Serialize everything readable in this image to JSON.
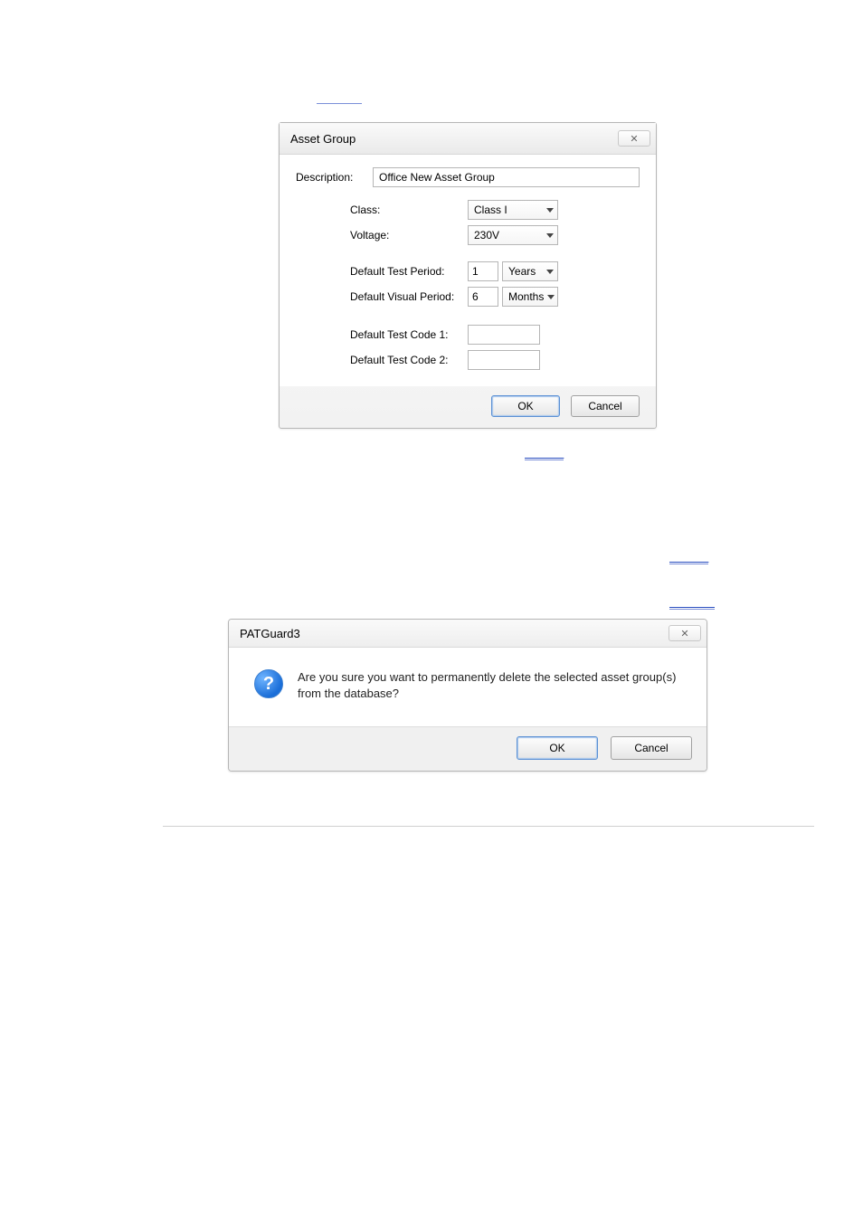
{
  "intro_link": "",
  "dialog1": {
    "title": "Asset Group",
    "close": "✕",
    "description_label": "Description:",
    "description_value": "Office New Asset Group",
    "class_label": "Class:",
    "class_value": "Class I",
    "voltage_label": "Voltage:",
    "voltage_value": "230V",
    "test_period_label": "Default Test Period:",
    "test_period_value": "1",
    "test_period_unit": "Years",
    "visual_period_label": "Default Visual Period:",
    "visual_period_value": "6",
    "visual_period_unit": "Months",
    "test_code1_label": "Default Test Code 1:",
    "test_code1_value": "",
    "test_code2_label": "Default Test Code 2:",
    "test_code2_value": "",
    "ok": "OK",
    "cancel": "Cancel"
  },
  "link_right1": "",
  "link_right2": "",
  "link_right3": "",
  "dialog2": {
    "title": "PATGuard3",
    "close": "✕",
    "question_mark": "?",
    "message": "Are you sure you want to permanently delete the selected asset group(s) from the database?",
    "ok": "OK",
    "cancel": "Cancel"
  }
}
